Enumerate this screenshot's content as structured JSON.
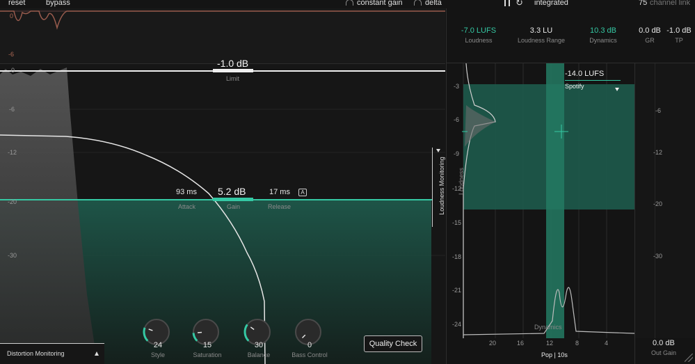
{
  "topbar": {
    "reset": "reset",
    "bypass": "bypass",
    "constant_gain": "constant gain",
    "delta": "delta",
    "mode": "integrated",
    "channel_link_value": "75",
    "channel_link_label": "channel link"
  },
  "limiter": {
    "limit_value": "-1.0 dB",
    "limit_label": "Limit",
    "attack_value": "93 ms",
    "attack_label": "Attack",
    "gain_value": "5.2 dB",
    "gain_label": "Gain",
    "release_value": "17 ms",
    "release_label": "Release",
    "auto_badge": "A",
    "top_scale": [
      "0",
      "-6"
    ],
    "scale": [
      "0",
      "-6",
      "-12",
      "-20",
      "-30"
    ],
    "gain_reduction_fraction": 0.3
  },
  "bottom_controls": {
    "distortion_monitoring": "Distortion Monitoring",
    "quality_check": "Quality Check",
    "knobs": [
      {
        "label": "Style",
        "value": "24",
        "level": 0.24
      },
      {
        "label": "Saturation",
        "value": "15",
        "level": 0.15
      },
      {
        "label": "Balance",
        "value": "30",
        "level": 0.3
      },
      {
        "label": "Bass Control",
        "value": "0",
        "level": 0.0
      }
    ]
  },
  "loudness_monitoring": "Loudness Monitoring",
  "stats": [
    {
      "value": "-7.0 LUFS",
      "label": "Loudness",
      "accent": true
    },
    {
      "value": "3.3 LU",
      "label": "Loudness Range",
      "accent": false
    },
    {
      "value": "10.3 dB",
      "label": "Dynamics",
      "accent": true
    },
    {
      "value": "0.0 dB",
      "label": "GR",
      "accent": false
    },
    {
      "value": "-1.0 dB",
      "label": "TP",
      "accent": false
    }
  ],
  "graph": {
    "target_value": "-14.0 LUFS",
    "target_preset": "Spotify",
    "loudness_axis_label": "Loudness",
    "dynamics_axis_label": "Dynamics",
    "y_scale": [
      "-3",
      "-6",
      "-9",
      "-12",
      "-15",
      "-18",
      "-21",
      "-24"
    ],
    "x_scale": [
      "20",
      "16",
      "12",
      "8",
      "4"
    ],
    "genre": "Pop | 10s"
  },
  "out_meter": {
    "scale": [
      "-6",
      "-12",
      "-20",
      "-30"
    ],
    "value": "0.0 dB",
    "label": "Out Gain"
  },
  "colors": {
    "accent": "#35c9a4",
    "background": "#141414",
    "panel": "#1b1b1b"
  }
}
